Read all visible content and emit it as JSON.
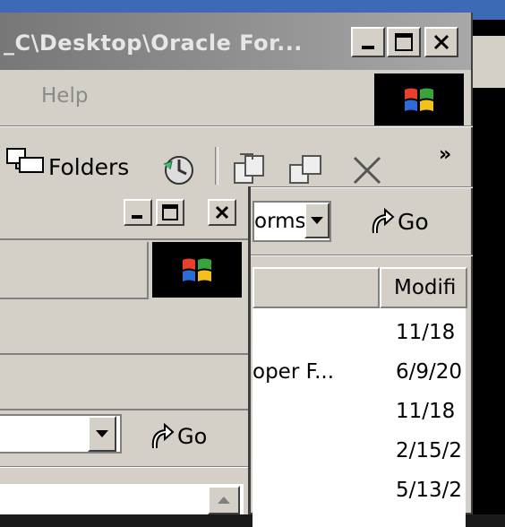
{
  "back_window": {
    "title": "_C\\Desktop\\Oracle For...",
    "menu_help": "Help",
    "toolbar_folders": "Folders",
    "toolbar_more": "»",
    "address_value": "orms",
    "go_label": "Go",
    "column_modified": "Modifi",
    "rows": [
      {
        "name": "",
        "modified": "11/18"
      },
      {
        "name": "oper F...",
        "modified": "6/9/20"
      },
      {
        "name": "",
        "modified": "11/18"
      },
      {
        "name": "",
        "modified": "2/15/2"
      },
      {
        "name": "",
        "modified": "5/13/2"
      }
    ]
  },
  "front_window": {
    "address_value": "",
    "go_label": "Go"
  },
  "icons": {
    "minimize": "minimize-icon",
    "maximize": "maximize-icon",
    "close": "close-icon",
    "windows_logo": "windows-logo",
    "go": "go-arrow-icon"
  },
  "colors": {
    "face": "#d4d0c8",
    "titlebar_inactive": "#8c8c8c",
    "desktop_bar": "#3c6ab4"
  }
}
